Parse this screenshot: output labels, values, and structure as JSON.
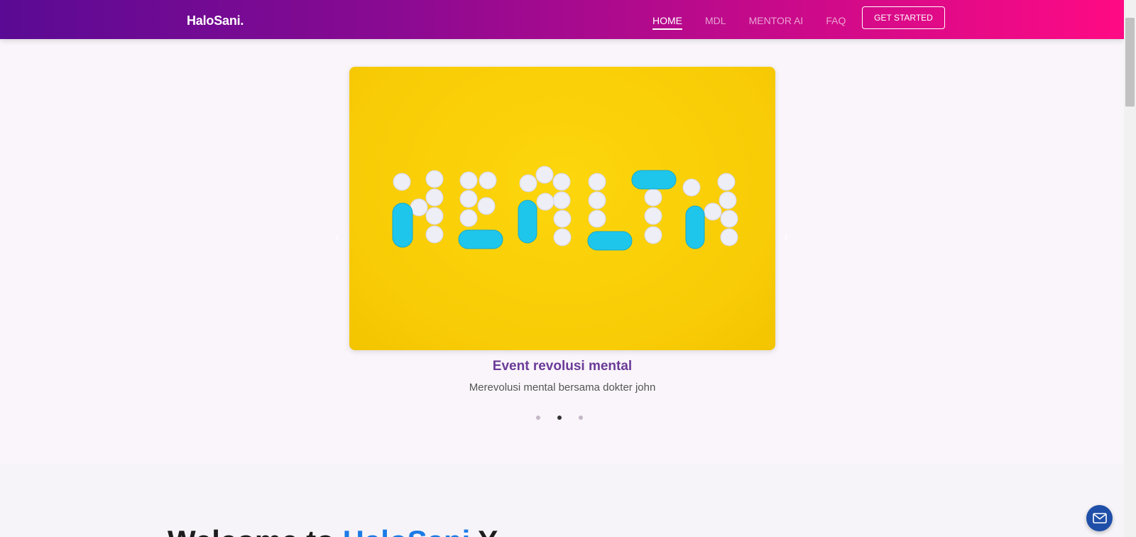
{
  "header": {
    "brand": "HaloSani.",
    "nav": [
      {
        "label": "HOME",
        "active": true
      },
      {
        "label": "MDL",
        "active": false
      },
      {
        "label": "MENTOR AI",
        "active": false
      },
      {
        "label": "FAQ",
        "active": false
      }
    ],
    "cta_label": "GET STARTED"
  },
  "carousel": {
    "caption_title": "Event revolusi mental",
    "caption_subtitle": "Merevolusi mental bersama dokter john",
    "slide_count": 3,
    "active_slide": 2,
    "prev_icon": "chevron-left-icon",
    "next_icon": "chevron-right-icon"
  },
  "welcome": {
    "prefix": "Welcome to ",
    "highlight": "HaloSani",
    "suffix": " Y"
  },
  "colors": {
    "header_gradient_start": "#5a0a94",
    "header_gradient_end": "#ff0a84",
    "caption_title": "#6b3b98",
    "accent_blue": "#1c7be6",
    "mail_button": "#1f4fa8"
  }
}
